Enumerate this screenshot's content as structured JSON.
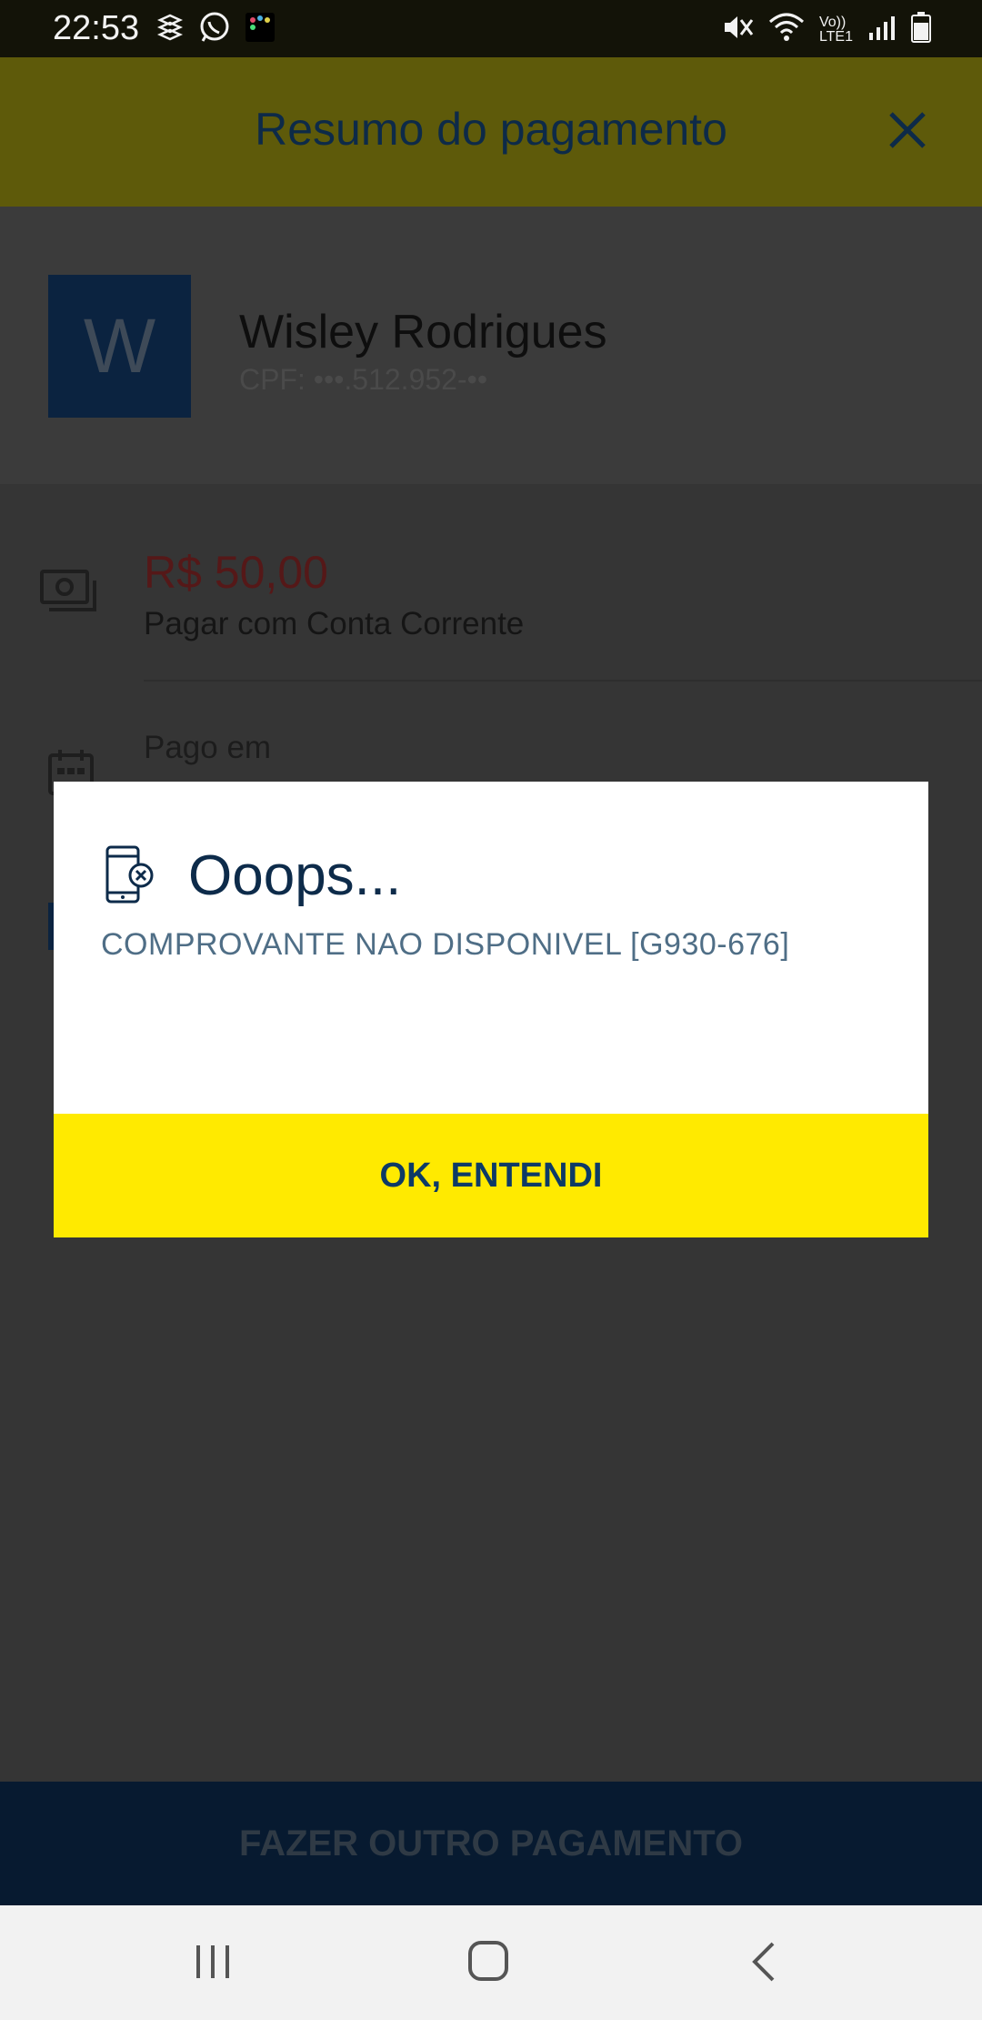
{
  "status_bar": {
    "time": "22:53",
    "left_icons": [
      "dropbox-icon",
      "whatsapp-icon",
      "app-notification-icon"
    ],
    "right_icons": [
      "mute-icon",
      "wifi-icon",
      "volte-lte-icon",
      "signal-icon",
      "battery-icon"
    ],
    "network_label_top": "Vo))",
    "network_label_bottom": "LTE1"
  },
  "header": {
    "title": "Resumo do pagamento",
    "close_icon": "close-icon"
  },
  "payee": {
    "avatar_letter": "W",
    "name": "Wisley Rodrigues",
    "cpf": "CPF: •••.512.952-••"
  },
  "details": {
    "amount": "R$ 50,00",
    "method": "Pagar com Conta Corrente",
    "paid_label": "Pago em"
  },
  "bottom_button": {
    "label": "FAZER OUTRO PAGAMENTO"
  },
  "dialog": {
    "icon": "phone-error-icon",
    "title": "Ooops...",
    "message": "COMPROVANTE NAO DISPONIVEL [G930-676]",
    "button_label": "OK, ENTENDI"
  },
  "nav_bar": {
    "items": [
      "recents-icon",
      "home-icon",
      "back-icon"
    ]
  },
  "colors": {
    "header_bg": "#5e5a0a",
    "dialog_button_bg": "#ffea00",
    "brand_navy": "#0d2b4a",
    "amount_red": "#551818"
  }
}
